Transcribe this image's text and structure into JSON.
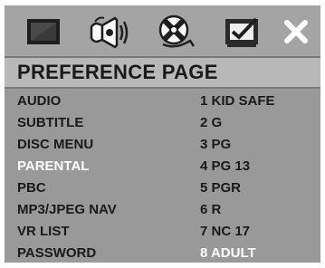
{
  "icons": [
    {
      "name": "display-icon"
    },
    {
      "name": "audio-speaker-icon"
    },
    {
      "name": "disc-icon"
    },
    {
      "name": "preference-check-icon"
    },
    {
      "name": "close-icon"
    }
  ],
  "page_title": "PREFERENCE PAGE",
  "menu_items": [
    {
      "label": "AUDIO",
      "active": false
    },
    {
      "label": "SUBTITLE",
      "active": false
    },
    {
      "label": "DISC MENU",
      "active": false
    },
    {
      "label": "PARENTAL",
      "active": true
    },
    {
      "label": "PBC",
      "active": false
    },
    {
      "label": "MP3/JPEG NAV",
      "active": false
    },
    {
      "label": "VR LIST",
      "active": false
    },
    {
      "label": "PASSWORD",
      "active": false
    }
  ],
  "parental_options": [
    {
      "label": "1 KID SAFE",
      "selected": false
    },
    {
      "label": "2 G",
      "selected": false
    },
    {
      "label": "3 PG",
      "selected": false
    },
    {
      "label": "4 PG 13",
      "selected": false
    },
    {
      "label": "5 PGR",
      "selected": false
    },
    {
      "label": "6 R",
      "selected": false
    },
    {
      "label": "7 NC 17",
      "selected": false
    },
    {
      "label": "8 ADULT",
      "selected": true
    }
  ],
  "colors": {
    "background": "#999999",
    "text": "#1a1a1a",
    "highlight_text": "#ffffff"
  }
}
